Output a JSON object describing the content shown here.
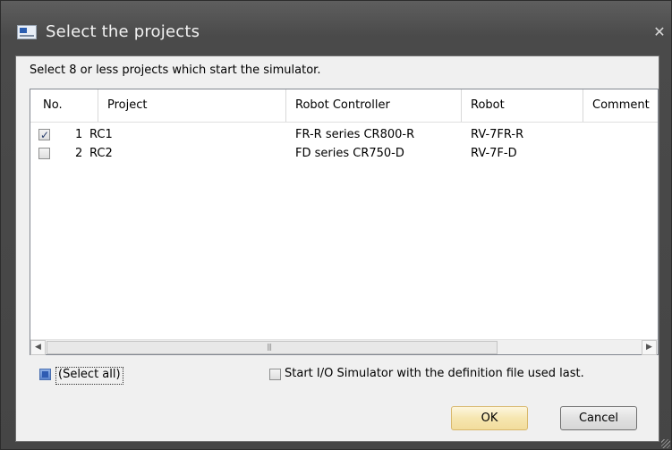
{
  "window": {
    "title": "Select the projects",
    "icon": "app-window-icon",
    "close_label": "✕"
  },
  "instruction": "Select 8 or less projects which start the simulator.",
  "table": {
    "columns": [
      "No.",
      "Project",
      "Robot Controller",
      "Robot",
      "Comment"
    ],
    "rows": [
      {
        "checked": true,
        "no": "1",
        "project": "RC1",
        "controller": "FR-R series CR800-R",
        "robot": "RV-7FR-R",
        "comment": ""
      },
      {
        "checked": false,
        "no": "2",
        "project": "RC2",
        "controller": "FD series CR750-D",
        "robot": "RV-7F-D",
        "comment": ""
      }
    ],
    "scroll_left": "◀",
    "scroll_right": "▶",
    "scroll_grip": "|||"
  },
  "select_all": {
    "label": "(Select all)",
    "state": "indeterminate"
  },
  "io_simulator": {
    "label": "Start I/O Simulator with the definition file used last.",
    "checked": false
  },
  "buttons": {
    "ok": "OK",
    "cancel": "Cancel"
  }
}
